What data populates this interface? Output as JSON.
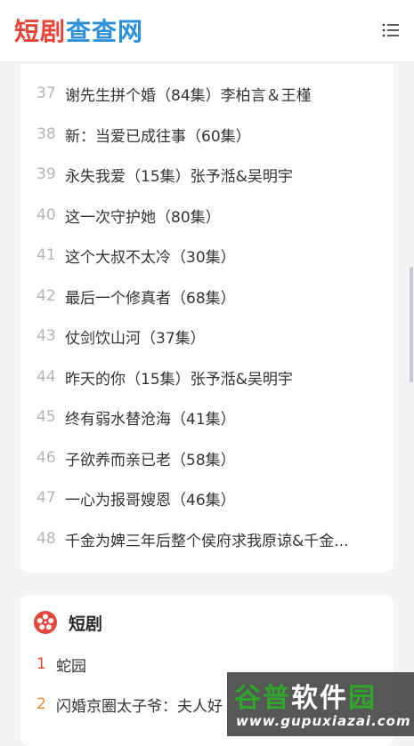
{
  "header": {
    "logo_part1": "短剧",
    "logo_part2": "查查网",
    "menu_icon": "hamburger-menu-icon"
  },
  "list": [
    {
      "num": "37",
      "title": "谢先生拼个婚（84集）李柏言＆王槿"
    },
    {
      "num": "38",
      "title": "新：当爱已成往事（60集）"
    },
    {
      "num": "39",
      "title": "永失我爱（15集）张予湉&吴明宇"
    },
    {
      "num": "40",
      "title": "这一次守护她（80集）"
    },
    {
      "num": "41",
      "title": "这个大叔不太冷（30集）"
    },
    {
      "num": "42",
      "title": "最后一个修真者（68集）"
    },
    {
      "num": "43",
      "title": "仗剑饮山河（37集）"
    },
    {
      "num": "44",
      "title": "昨天的你（15集）张予湉&吴明宇"
    },
    {
      "num": "45",
      "title": "终有弱水替沧海（41集）"
    },
    {
      "num": "46",
      "title": "子欲养而亲已老（58集）"
    },
    {
      "num": "47",
      "title": "一心为报哥嫂恩（46集）"
    },
    {
      "num": "48",
      "title": "千金为婢三年后整个侯府求我原谅&千金..."
    }
  ],
  "section": {
    "title": "短剧",
    "icon": "film-reel-icon",
    "items": [
      {
        "rank": "1",
        "title": "蛇园",
        "color": "#e4473a"
      },
      {
        "rank": "2",
        "title": "闪婚京圈太子爷：夫人好",
        "color": "#f08a24"
      }
    ]
  },
  "watermark": {
    "title_green1": "谷普",
    "title_white": "软件",
    "title_green2": "园",
    "url": "www.gupuxiazai.com"
  },
  "colors": {
    "logo_red": "#e4473a",
    "logo_blue": "#2c8fd9",
    "number_gray": "#b3b5bb",
    "rank1": "#e4473a",
    "rank2": "#f08a24",
    "watermark_green": "#2fa52b"
  }
}
